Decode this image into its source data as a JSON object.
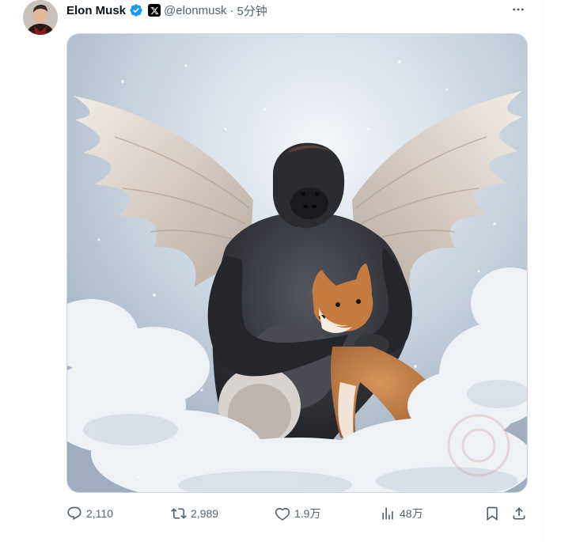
{
  "author": {
    "display_name": "Elon Musk",
    "handle": "@elonmusk",
    "separator": "·",
    "time": "5分钟"
  },
  "badges": {
    "verified_color": "#1d9bf0",
    "affiliate_icon": "x-logo-icon"
  },
  "media": {
    "subject": "gorilla-with-angel-wings-and-shiba-inu"
  },
  "stats": {
    "replies": "2,110",
    "reposts": "2,989",
    "likes": "1.9万",
    "views": "48万"
  },
  "icons": {
    "more": "more-dots-icon",
    "reply": "reply-bubble-icon",
    "repost": "repost-arrows-icon",
    "like": "heart-icon",
    "views": "bar-chart-icon",
    "bookmark": "bookmark-icon",
    "share": "share-upload-icon"
  },
  "colors": {
    "text_primary": "#0f1419",
    "text_secondary": "#536471",
    "border": "#cfd9de"
  }
}
